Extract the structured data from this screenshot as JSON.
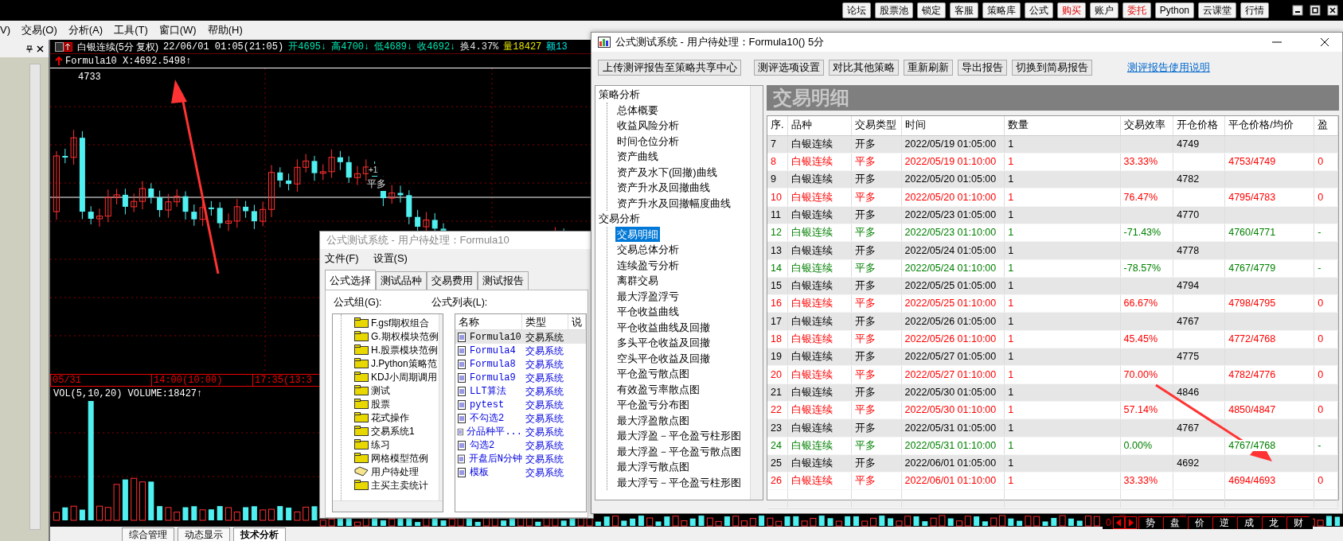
{
  "topbar": {
    "buttons": [
      {
        "label": "论坛",
        "alert": false
      },
      {
        "label": "股票池",
        "alert": false
      },
      {
        "label": "锁定",
        "alert": false
      },
      {
        "label": "客服",
        "alert": false
      },
      {
        "label": "策略库",
        "alert": false
      },
      {
        "label": "公式",
        "alert": false
      },
      {
        "label": "购买",
        "alert": true
      },
      {
        "label": "账户",
        "alert": false
      },
      {
        "label": "委托",
        "alert": true
      },
      {
        "label": "Python",
        "alert": false
      },
      {
        "label": "云课堂",
        "alert": false
      },
      {
        "label": "行情",
        "alert": false
      }
    ]
  },
  "menubar": {
    "items": [
      "V)",
      "交易(O)",
      "分析(A)",
      "工具(T)",
      "窗口(W)",
      "帮助(H)"
    ]
  },
  "chart": {
    "title": "白银连续(5分 复权)",
    "datetime": "22/06/01 01:05(21:05)",
    "quotes": [
      {
        "text": "开4695↓",
        "color": "#00e6b0"
      },
      {
        "text": "高4700↓",
        "color": "#00e6b0"
      },
      {
        "text": "低4689↓",
        "color": "#00e6b0"
      },
      {
        "text": "收4692↓",
        "color": "#00e6b0"
      },
      {
        "text": "换4.37%",
        "color": "#e0e0e0"
      },
      {
        "text": "量18427",
        "color": "#e6e600"
      },
      {
        "text": "额13",
        "color": "#00e6e6"
      }
    ],
    "formula_line": "Formula10 X:4692.5498↑",
    "high_label": "4733",
    "signal_count": "+1",
    "signal_label": "平多",
    "time_axis": [
      "05/31",
      "14:00(10:00)",
      "17:35(13:3"
    ],
    "volume_label": "VOL(5,10,20) VOLUME:18427↑",
    "bottom_tabs": [
      {
        "label": "综合管理",
        "selected": false
      },
      {
        "label": "动态显示",
        "selected": false
      },
      {
        "label": "技术分析",
        "selected": true
      }
    ],
    "strip_value": "0",
    "strip_tabs": [
      "势",
      "盘",
      "价",
      "逆",
      "成",
      "龙",
      "财"
    ]
  },
  "formula_window": {
    "title": "公式测试系统 - 用户待处理：Formula10",
    "menu": [
      "文件(F)",
      "设置(S)"
    ],
    "tabs": [
      {
        "label": "公式选择",
        "selected": true
      },
      {
        "label": "测试品种",
        "selected": false
      },
      {
        "label": "交易费用",
        "selected": false
      },
      {
        "label": "测试报告",
        "selected": false
      }
    ],
    "group_label": "公式组(G):",
    "list_label": "公式列表(L):",
    "groups": [
      {
        "label": "F.gsf期权组合",
        "selected": false
      },
      {
        "label": "G.期权模块范例",
        "selected": false
      },
      {
        "label": "H.股票模块范例",
        "selected": false
      },
      {
        "label": "J.Python策略范",
        "selected": false
      },
      {
        "label": "KDJ小周期调用",
        "selected": false
      },
      {
        "label": "测试",
        "selected": false
      },
      {
        "label": "股票",
        "selected": false
      },
      {
        "label": "花式操作",
        "selected": false
      },
      {
        "label": "交易系统1",
        "selected": false
      },
      {
        "label": "练习",
        "selected": false
      },
      {
        "label": "网格模型范例",
        "selected": false
      },
      {
        "label": "用户待处理",
        "selected": true
      },
      {
        "label": "主买主卖统计",
        "selected": false
      }
    ],
    "list_columns": [
      "名称",
      "类型",
      "说"
    ],
    "formulas": [
      {
        "name": "Formula10",
        "type": "交易系统",
        "selected": true
      },
      {
        "name": "Formula4",
        "type": "交易系统",
        "selected": false
      },
      {
        "name": "Formula8",
        "type": "交易系统",
        "selected": false
      },
      {
        "name": "Formula9",
        "type": "交易系统",
        "selected": false
      },
      {
        "name": "LLT算法",
        "type": "交易系统",
        "selected": false
      },
      {
        "name": "pytest",
        "type": "交易系统",
        "selected": false
      },
      {
        "name": "不勾选2",
        "type": "交易系统",
        "selected": false
      },
      {
        "name": "分品种平...",
        "type": "交易系统",
        "selected": false
      },
      {
        "name": "勾选2",
        "type": "交易系统",
        "selected": false
      },
      {
        "name": "开盘后N分钟",
        "type": "交易系统",
        "selected": false
      },
      {
        "name": "模板",
        "type": "交易系统",
        "selected": false
      }
    ]
  },
  "report_window": {
    "title": "公式测试系统 - 用户待处理：Formula10() 5分",
    "toolbar": [
      "上传测评报告至策略共享中心",
      "测评选项设置",
      "对比其他策略",
      "重新刷新",
      "导出报告",
      "切换到简易报告"
    ],
    "help_link": "测评报告使用说明",
    "tree": [
      {
        "label": "策略分析",
        "children": [
          {
            "label": "总体概要",
            "selected": false
          },
          {
            "label": "收益风险分析",
            "selected": false
          },
          {
            "label": "时间仓位分析",
            "selected": false
          },
          {
            "label": "资产曲线",
            "selected": false
          },
          {
            "label": "资产及水下(回撤)曲线",
            "selected": false
          },
          {
            "label": "资产升水及回撤曲线",
            "selected": false
          },
          {
            "label": "资产升水及回撤幅度曲线",
            "selected": false
          }
        ]
      },
      {
        "label": "交易分析",
        "children": [
          {
            "label": "交易明细",
            "selected": true
          },
          {
            "label": "交易总体分析",
            "selected": false
          },
          {
            "label": "连续盈亏分析",
            "selected": false
          },
          {
            "label": "离群交易",
            "selected": false
          },
          {
            "label": "最大浮盈浮亏",
            "selected": false
          },
          {
            "label": "平仓收益曲线",
            "selected": false
          },
          {
            "label": "平仓收益曲线及回撤",
            "selected": false
          },
          {
            "label": "多头平仓收益及回撤",
            "selected": false
          },
          {
            "label": "空头平仓收益及回撤",
            "selected": false
          },
          {
            "label": "平仓盈亏散点图",
            "selected": false
          },
          {
            "label": "有效盈亏率散点图",
            "selected": false
          },
          {
            "label": "平仓盈亏分布图",
            "selected": false
          },
          {
            "label": "最大浮盈散点图",
            "selected": false
          },
          {
            "label": "最大浮盈－平仓盈亏柱形图",
            "selected": false
          },
          {
            "label": "最大浮盈－平仓盈亏散点图",
            "selected": false
          },
          {
            "label": "最大浮亏散点图",
            "selected": false
          },
          {
            "label": "最大浮亏－平仓盈亏柱形图",
            "selected": false
          }
        ]
      }
    ],
    "banner": "交易明细",
    "columns": [
      "序.",
      "品种",
      "交易类型",
      "时间",
      "数量",
      "交易效率",
      "开仓价格",
      "平仓价格/均价",
      "盈"
    ],
    "rows": [
      {
        "no": "7",
        "symbol": "白银连续",
        "type": "开多",
        "time": "2022/05/19 01:05:00",
        "qty": "1",
        "open_price": "4749",
        "color": "#000000"
      },
      {
        "no": "8",
        "symbol": "白银连续",
        "type": "平多",
        "time": "2022/05/19 01:10:00",
        "qty": "1",
        "efficiency": "33.33%",
        "close_price": "4753/4749",
        "column_9": "0",
        "color": "#ff0000"
      },
      {
        "no": "9",
        "symbol": "白银连续",
        "type": "开多",
        "time": "2022/05/20 01:05:00",
        "qty": "1",
        "open_price": "4782",
        "color": "#000000"
      },
      {
        "no": "10",
        "symbol": "白银连续",
        "type": "平多",
        "time": "2022/05/20 01:10:00",
        "qty": "1",
        "efficiency": "76.47%",
        "close_price": "4795/4783",
        "column_9": "0",
        "color": "#ff0000"
      },
      {
        "no": "11",
        "symbol": "白银连续",
        "type": "开多",
        "time": "2022/05/23 01:05:00",
        "qty": "1",
        "open_price": "4770",
        "color": "#000000"
      },
      {
        "no": "12",
        "symbol": "白银连续",
        "type": "平多",
        "time": "2022/05/23 01:10:00",
        "qty": "1",
        "efficiency": "-71.43%",
        "close_price": "4760/4771",
        "column_9": "-",
        "color": "#008000"
      },
      {
        "no": "13",
        "symbol": "白银连续",
        "type": "开多",
        "time": "2022/05/24 01:05:00",
        "qty": "1",
        "open_price": "4778",
        "color": "#000000"
      },
      {
        "no": "14",
        "symbol": "白银连续",
        "type": "平多",
        "time": "2022/05/24 01:10:00",
        "qty": "1",
        "efficiency": "-78.57%",
        "close_price": "4767/4779",
        "column_9": "-",
        "color": "#008000"
      },
      {
        "no": "15",
        "symbol": "白银连续",
        "type": "开多",
        "time": "2022/05/25 01:05:00",
        "qty": "1",
        "open_price": "4794",
        "color": "#000000"
      },
      {
        "no": "16",
        "symbol": "白银连续",
        "type": "平多",
        "time": "2022/05/25 01:10:00",
        "qty": "1",
        "efficiency": "66.67%",
        "close_price": "4798/4795",
        "column_9": "0",
        "color": "#ff0000"
      },
      {
        "no": "17",
        "symbol": "白银连续",
        "type": "开多",
        "time": "2022/05/26 01:05:00",
        "qty": "1",
        "open_price": "4767",
        "color": "#000000"
      },
      {
        "no": "18",
        "symbol": "白银连续",
        "type": "平多",
        "time": "2022/05/26 01:10:00",
        "qty": "1",
        "efficiency": "45.45%",
        "close_price": "4772/4768",
        "column_9": "0",
        "color": "#ff0000"
      },
      {
        "no": "19",
        "symbol": "白银连续",
        "type": "开多",
        "time": "2022/05/27 01:05:00",
        "qty": "1",
        "open_price": "4775",
        "color": "#000000"
      },
      {
        "no": "20",
        "symbol": "白银连续",
        "type": "平多",
        "time": "2022/05/27 01:10:00",
        "qty": "1",
        "efficiency": "70.00%",
        "close_price": "4782/4776",
        "column_9": "0",
        "color": "#ff0000"
      },
      {
        "no": "21",
        "symbol": "白银连续",
        "type": "开多",
        "time": "2022/05/30 01:05:00",
        "qty": "1",
        "open_price": "4846",
        "color": "#000000"
      },
      {
        "no": "22",
        "symbol": "白银连续",
        "type": "平多",
        "time": "2022/05/30 01:10:00",
        "qty": "1",
        "efficiency": "57.14%",
        "close_price": "4850/4847",
        "column_9": "0",
        "color": "#ff0000"
      },
      {
        "no": "23",
        "symbol": "白银连续",
        "type": "开多",
        "time": "2022/05/31 01:05:00",
        "qty": "1",
        "open_price": "4767",
        "color": "#000000"
      },
      {
        "no": "24",
        "symbol": "白银连续",
        "type": "平多",
        "time": "2022/05/31 01:10:00",
        "qty": "1",
        "efficiency": "0.00%",
        "close_price": "4767/4768",
        "column_9": "-",
        "color": "#008000"
      },
      {
        "no": "25",
        "symbol": "白银连续",
        "type": "开多",
        "time": "2022/06/01 01:05:00",
        "qty": "1",
        "open_price": "4692",
        "color": "#000000"
      },
      {
        "no": "26",
        "symbol": "白银连续",
        "type": "平多",
        "time": "2022/06/01 01:10:00",
        "qty": "1",
        "efficiency": "33.33%",
        "close_price": "4694/4693",
        "column_9": "0",
        "color": "#ff0000"
      }
    ]
  }
}
